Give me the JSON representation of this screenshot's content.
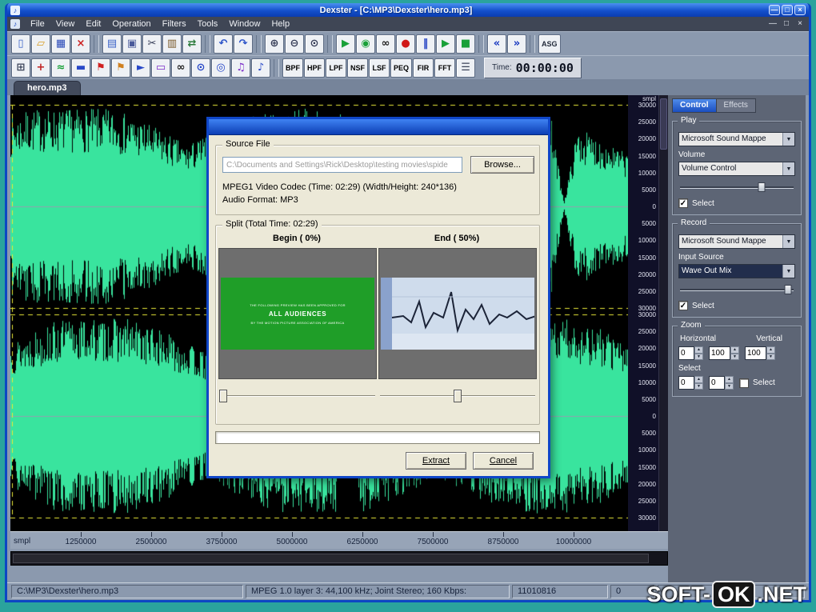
{
  "window": {
    "title": "Dexster - [C:\\MP3\\Dexster\\hero.mp3]",
    "app_icon": "♪",
    "controls": [
      {
        "name": "minimize",
        "glyph": "—"
      },
      {
        "name": "maximize",
        "glyph": "□"
      },
      {
        "name": "close",
        "glyph": "×"
      }
    ]
  },
  "mdi_controls": [
    {
      "name": "mdi-minimize",
      "glyph": "—"
    },
    {
      "name": "mdi-restore",
      "glyph": "□"
    },
    {
      "name": "mdi-close",
      "glyph": "×"
    }
  ],
  "menubar": {
    "items": [
      "File",
      "View",
      "Edit",
      "Operation",
      "Filters",
      "Tools",
      "Window",
      "Help"
    ]
  },
  "toolbar_main": [
    {
      "name": "new-file",
      "glyph": "▯",
      "color": "#3a62c8"
    },
    {
      "name": "open-file",
      "glyph": "▱",
      "color": "#d89c20"
    },
    {
      "name": "save-file",
      "glyph": "▦",
      "color": "#2848b8"
    },
    {
      "name": "close-file",
      "glyph": "×",
      "color": "#cc2222"
    },
    {
      "sep": true
    },
    {
      "name": "batch-convert",
      "glyph": "▤",
      "color": "#3a62c8"
    },
    {
      "name": "copy",
      "glyph": "▣",
      "color": "#4a5a9a"
    },
    {
      "name": "cut",
      "glyph": "✂",
      "color": "#333a55"
    },
    {
      "name": "paste",
      "glyph": "▥",
      "color": "#7a5a2a"
    },
    {
      "name": "mix",
      "glyph": "⇄",
      "color": "#2a7a3a"
    },
    {
      "sep": true
    },
    {
      "name": "undo",
      "glyph": "↶",
      "color": "#2a52c8"
    },
    {
      "name": "redo",
      "glyph": "↷",
      "color": "#2a52c8"
    },
    {
      "sep": true
    },
    {
      "name": "zoom-in",
      "glyph": "⊕",
      "color": "#333a55"
    },
    {
      "name": "zoom-out",
      "glyph": "⊖",
      "color": "#333a55"
    },
    {
      "name": "zoom-selection",
      "glyph": "⊙",
      "color": "#333a55"
    },
    {
      "sep": true
    },
    {
      "name": "play",
      "glyph": "▶",
      "color": "#18a038"
    },
    {
      "name": "play-all",
      "glyph": "◉",
      "color": "#18a038"
    },
    {
      "name": "loop",
      "glyph": "∞",
      "color": "#222222"
    },
    {
      "name": "record",
      "glyph": "●",
      "color": "#d01818"
    },
    {
      "name": "pause",
      "glyph": "‖",
      "color": "#1838c0"
    },
    {
      "name": "play-selection",
      "glyph": "▶",
      "color": "#18a038"
    },
    {
      "name": "stop",
      "glyph": "■",
      "color": "#18a038"
    },
    {
      "sep": true
    },
    {
      "name": "seek-start",
      "glyph": "«",
      "color": "#1838c0"
    },
    {
      "name": "seek-end",
      "glyph": "»",
      "color": "#1838c0"
    },
    {
      "sep": true
    },
    {
      "name": "asg",
      "glyph": "ASG",
      "color": "#222a3a",
      "text": true
    }
  ],
  "toolbar_edit": [
    {
      "name": "maximize-view",
      "glyph": "⊞",
      "color": "#3a4258"
    },
    {
      "name": "add-marker",
      "glyph": "+",
      "color": "#c02020"
    },
    {
      "name": "waveform-stats",
      "glyph": "≈",
      "color": "#18a038"
    },
    {
      "name": "baseline",
      "glyph": "▬",
      "color": "#2848c8"
    },
    {
      "name": "flag-start",
      "glyph": "⚑",
      "color": "#d02020"
    },
    {
      "name": "flag-end",
      "glyph": "⚑",
      "color": "#d08020"
    },
    {
      "name": "goto-marker",
      "glyph": "►",
      "color": "#2848c8"
    },
    {
      "name": "envelope",
      "glyph": "▭",
      "color": "#7a2ac8"
    },
    {
      "name": "loop-selection",
      "glyph": "∞",
      "color": "#222222"
    },
    {
      "name": "cue-a",
      "glyph": "⊙",
      "color": "#2848c8"
    },
    {
      "name": "cue-b",
      "glyph": "◎",
      "color": "#2848c8"
    },
    {
      "name": "id3-tag",
      "glyph": "♫",
      "color": "#7a2ac8"
    },
    {
      "name": "media-info",
      "glyph": "♪",
      "color": "#2848c8"
    }
  ],
  "filter_buttons": [
    "BPF",
    "HPF",
    "LPF",
    "NSF",
    "LSF",
    "PEQ",
    "FIR",
    "FFT"
  ],
  "equalizer_glyph": "☰",
  "timer": {
    "label": "Time:",
    "value": "00:00:00"
  },
  "document_tab": "hero.mp3",
  "scale": {
    "unit": "smpl",
    "channel_values": [
      "30000",
      "25000",
      "20000",
      "15000",
      "10000",
      "5000",
      "0",
      "5000",
      "10000",
      "15000",
      "20000",
      "25000",
      "30000"
    ]
  },
  "ruler": {
    "unit": "smpl",
    "marks": [
      "1250000",
      "2500000",
      "3750000",
      "5000000",
      "6250000",
      "7500000",
      "8750000",
      "10000000"
    ]
  },
  "side_panel": {
    "tabs": [
      {
        "label": "Control",
        "active": true
      },
      {
        "label": "Effects",
        "active": false
      }
    ],
    "play": {
      "title": "Play",
      "device": "Microsoft Sound Mappe",
      "volume_label": "Volume",
      "volume_device": "Volume Control",
      "slider_pos": 0.72,
      "select_label": "Select",
      "select_checked": true
    },
    "record": {
      "title": "Record",
      "device": "Microsoft Sound Mappe",
      "input_label": "Input Source",
      "input_device": "Wave Out Mix",
      "slider_pos": 0.95,
      "select_label": "Select",
      "select_checked": true
    },
    "zoom": {
      "title": "Zoom",
      "horizontal_label": "Horizontal",
      "vertical_label": "Vertical",
      "values": [
        "0",
        "100",
        "100"
      ],
      "select_label": "Select",
      "select_values": [
        "0",
        "0"
      ],
      "select_checkbox_label": "Select",
      "select_checked": false
    }
  },
  "dialog": {
    "title": "",
    "source_group": "Source File",
    "path_value": "C:\\Documents and Settings\\Rick\\Desktop\\testing movies\\spide",
    "browse_label": "Browse...",
    "codec_info": "MPEG1 Video Codec (Time: 02:29)  (Width/Height: 240*136)",
    "audio_info": "Audio Format: MP3",
    "split_group": "Split  (Total Time: 02:29)",
    "begin_label": "Begin ( 0%)",
    "end_label": "End ( 50%)",
    "begin_slider_pos": 0.03,
    "end_slider_pos": 0.5,
    "preview_text": [
      "THE FOLLOWING PREVIEW HAS BEEN APPROVED FOR",
      "ALL AUDIENCES",
      "BY THE MOTION PICTURE ASSOCIATION OF AMERICA"
    ],
    "extract_label": "Extract",
    "cancel_label": "Cancel"
  },
  "statusbar": {
    "file": "C:\\MP3\\Dexster\\hero.mp3",
    "format": "MPEG 1.0 layer 3: 44,100 kHz; Joint Stereo; 160 Kbps:",
    "size": "11010816",
    "position": "0"
  },
  "watermark": {
    "part1": "SOFT-",
    "part2": "OK",
    "part3": ".NET"
  },
  "colors": {
    "wave": "#39e49e",
    "wave_bg": "#000000",
    "accent_blue": "#0c46c4",
    "dash_yellow": "#e8e838"
  }
}
